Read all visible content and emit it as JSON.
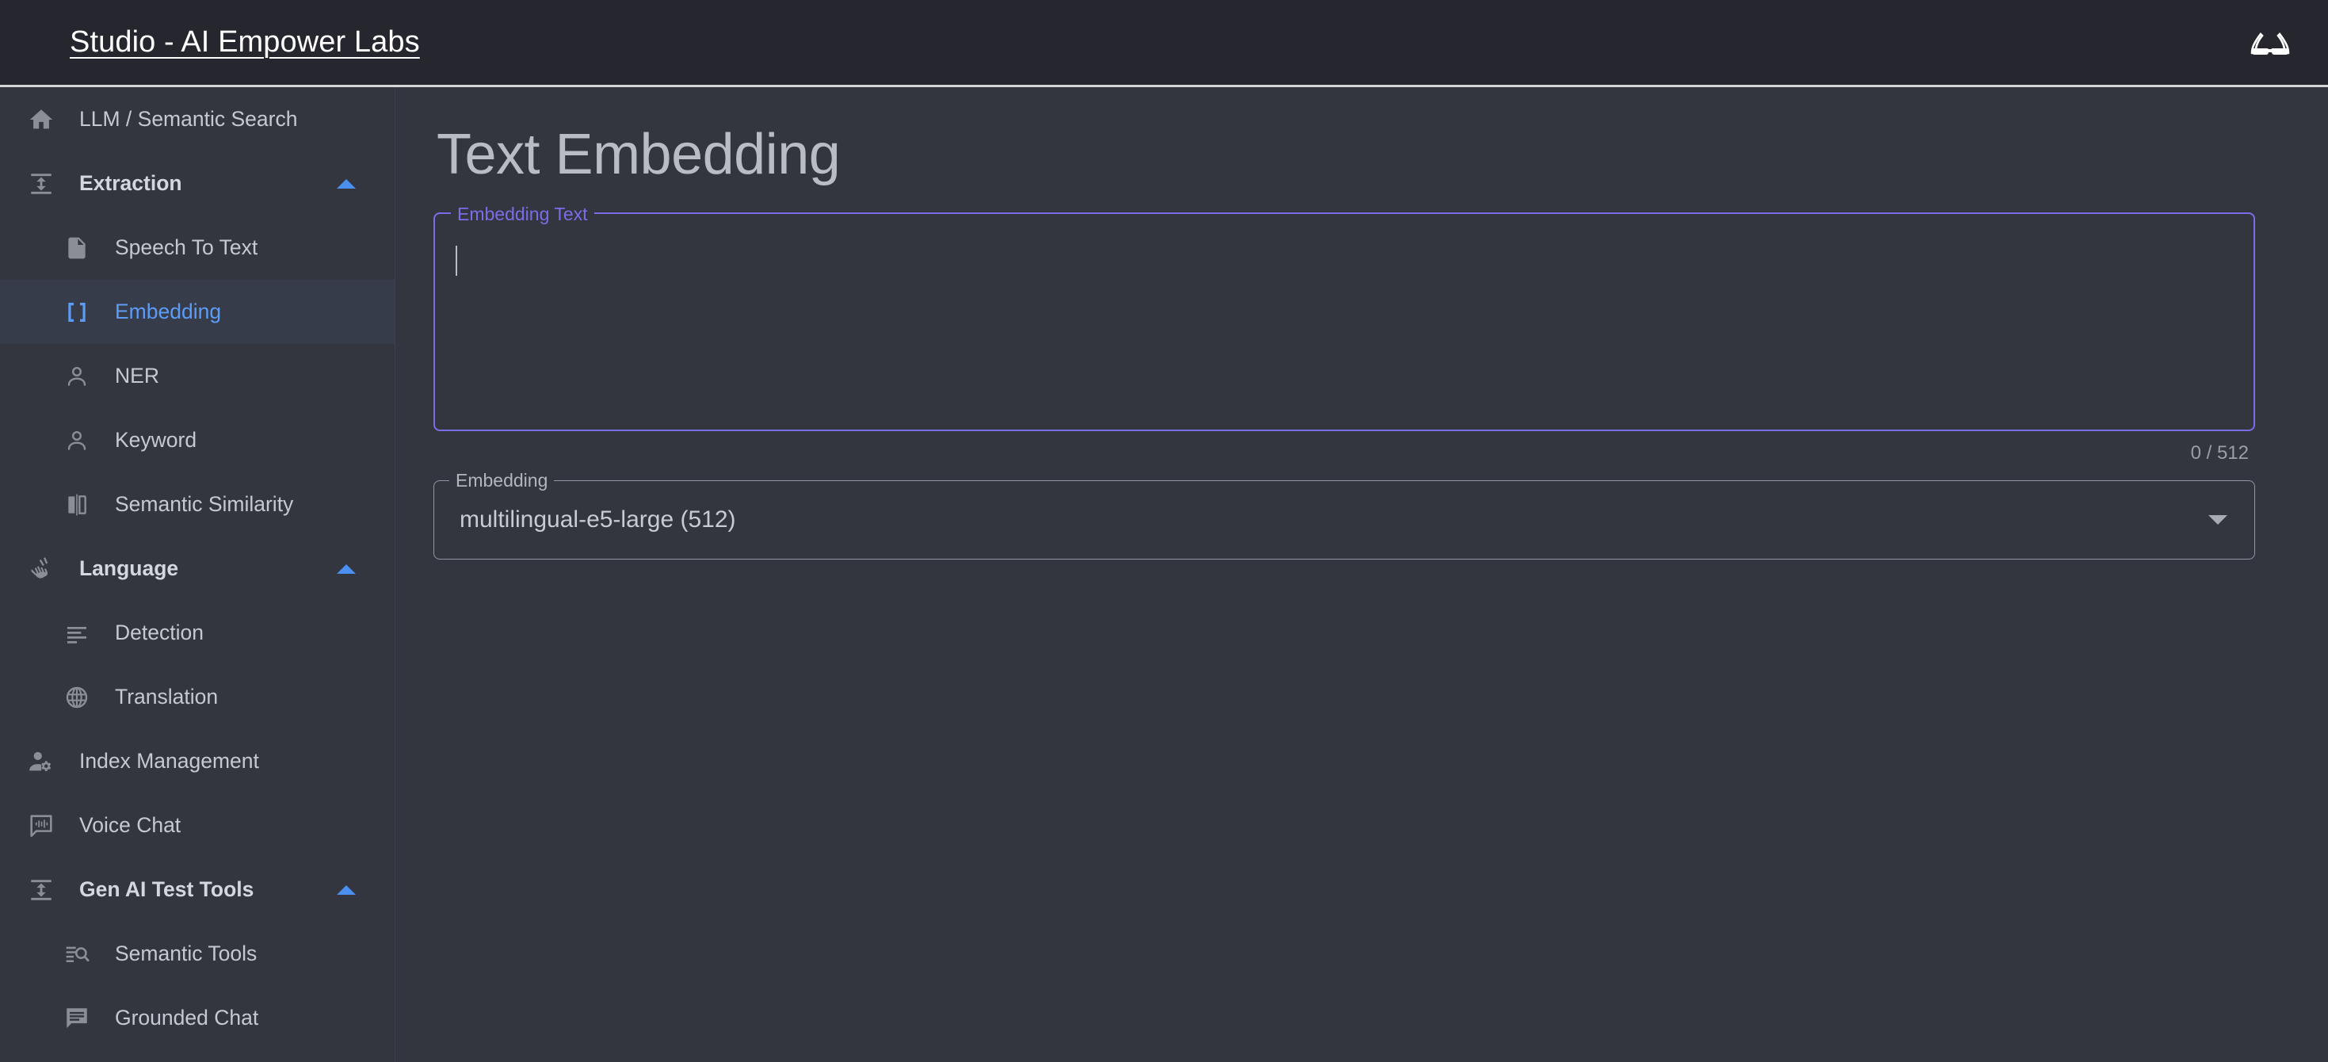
{
  "header": {
    "app_title": "Studio - AI Empower Labs",
    "right_icon": "glasses-icon"
  },
  "sidebar": {
    "items": [
      {
        "label": "LLM / Semantic Search",
        "icon": "home-icon",
        "type": "link",
        "selected": false
      },
      {
        "label": "Extraction",
        "icon": "height-icon",
        "type": "group",
        "expanded": true,
        "chevron": "chevron-up-icon"
      },
      {
        "label": "Speech To Text",
        "icon": "audio-file-icon",
        "type": "child",
        "selected": false
      },
      {
        "label": "Embedding",
        "icon": "brackets-icon",
        "type": "child",
        "selected": true
      },
      {
        "label": "NER",
        "icon": "person-icon",
        "type": "child",
        "selected": false
      },
      {
        "label": "Keyword",
        "icon": "person-icon",
        "type": "child",
        "selected": false
      },
      {
        "label": "Semantic Similarity",
        "icon": "compare-icon",
        "type": "child",
        "selected": false
      },
      {
        "label": "Language",
        "icon": "sign-language-icon",
        "type": "group",
        "expanded": true,
        "chevron": "chevron-up-icon"
      },
      {
        "label": "Detection",
        "icon": "text-lines-icon",
        "type": "child",
        "selected": false
      },
      {
        "label": "Translation",
        "icon": "globe-icon",
        "type": "child",
        "selected": false
      },
      {
        "label": "Index Management",
        "icon": "person-gear-icon",
        "type": "link",
        "selected": false
      },
      {
        "label": "Voice Chat",
        "icon": "voice-bubble-icon",
        "type": "link",
        "selected": false
      },
      {
        "label": "Gen AI Test Tools",
        "icon": "height-icon",
        "type": "group",
        "expanded": true,
        "chevron": "chevron-up-icon"
      },
      {
        "label": "Semantic Tools",
        "icon": "search-lines-icon",
        "type": "child",
        "selected": false
      },
      {
        "label": "Grounded Chat",
        "icon": "chat-bubble-icon",
        "type": "child",
        "selected": false
      }
    ]
  },
  "main": {
    "page_title": "Text Embedding",
    "embedding_text_field": {
      "legend": "Embedding Text",
      "value": "",
      "placeholder": "",
      "counter": "0 / 512"
    },
    "embedding_model_field": {
      "legend": "Embedding",
      "value": "multilingual-e5-large (512)",
      "arrow_icon": "chevron-down-icon"
    }
  },
  "colors": {
    "accent_blue": "#5c9cf5",
    "accent_purple": "#7a6ee8",
    "header_bg": "#26272e",
    "body_bg": "#33353f",
    "selected_bg": "#373c4b",
    "text_muted": "#9b9ea6"
  }
}
